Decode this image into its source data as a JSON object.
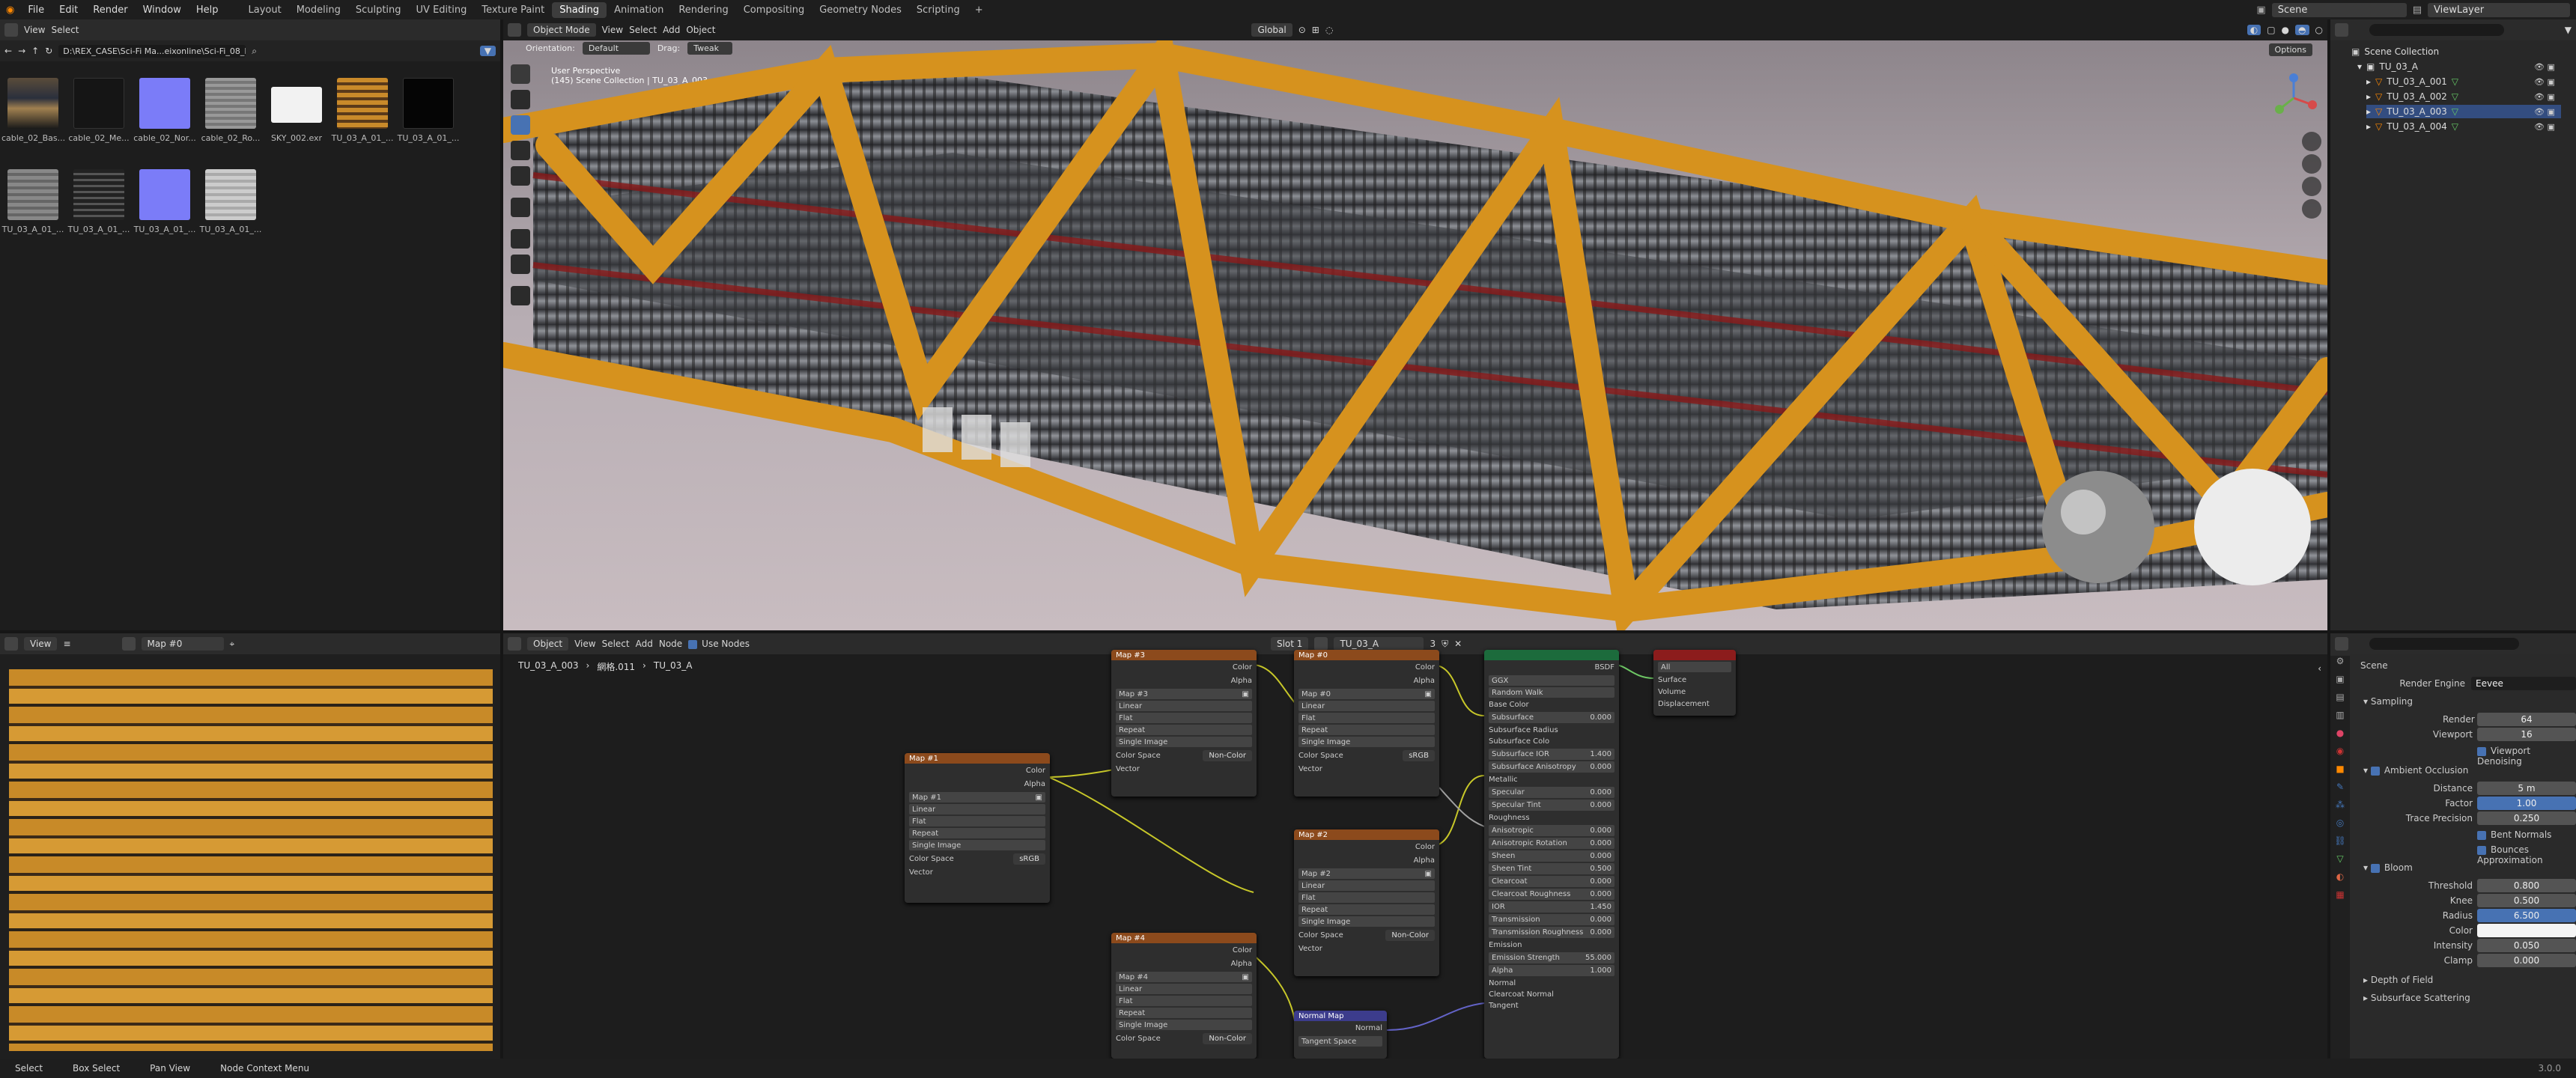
{
  "topmenu": {
    "items": [
      "File",
      "Edit",
      "Render",
      "Window",
      "Help"
    ],
    "workspaces": [
      "Layout",
      "Modeling",
      "Sculpting",
      "UV Editing",
      "Texture Paint",
      "Shading",
      "Animation",
      "Rendering",
      "Compositing",
      "Geometry Nodes",
      "Scripting"
    ],
    "active_workspace": "Shading",
    "scene": "Scene",
    "view_layer": "ViewLayer"
  },
  "filebrowser": {
    "menus": [
      "View",
      "Select"
    ],
    "path": "D:\\REX_CASE\\Sci-Fi Ma...eixonline\\Sci-Fi_08_Free\\",
    "files": [
      "cable_02_Bas...",
      "cable_02_Me...",
      "cable_02_Nor...",
      "cable_02_Ro...",
      "SKY_002.exr",
      "TU_03_A_01_...",
      "TU_03_A_01_...",
      "TU_03_A_01_...",
      "TU_03_A_01_...",
      "TU_03_A_01_...",
      "TU_03_A_01_..."
    ]
  },
  "viewport": {
    "mode": "Object Mode",
    "menus": [
      "View",
      "Select",
      "Add",
      "Object"
    ],
    "orientation_label": "Orientation:",
    "orientation": "Default",
    "drag_label": "Drag:",
    "drag": "Tweak",
    "transform": "Global",
    "options": "Options",
    "overlay_title": "User Perspective",
    "overlay_sub": "(145) Scene Collection | TU_03_A_003"
  },
  "image_editor": {
    "view": "View",
    "image": "Map #0"
  },
  "node_editor": {
    "mode": "Object",
    "menus": [
      "View",
      "Select",
      "Add",
      "Node"
    ],
    "use_nodes": "Use Nodes",
    "slot": "Slot 1",
    "material": "TU_03_A",
    "users": "3",
    "breadcrumb": [
      "TU_03_A_003",
      "網格.011",
      "TU_03_A"
    ],
    "nodes": {
      "map1": {
        "title": "Map #1",
        "image": "Map #1",
        "colorspace": "sRGB"
      },
      "map3": {
        "title": "Map #3",
        "image": "Map #3",
        "colorspace": "Non-Color"
      },
      "map0": {
        "title": "Map #0",
        "image": "Map #0",
        "colorspace": "sRGB"
      },
      "map2": {
        "title": "Map #2",
        "image": "Map #2",
        "colorspace": "Non-Color"
      },
      "map4": {
        "title": "Map #4",
        "image": "Map #4",
        "colorspace": "Non-Color"
      },
      "normalmap": {
        "title": "Normal Map",
        "out": "Normal",
        "space": "Tangent Space"
      },
      "common": {
        "color": "Color",
        "alpha": "Alpha",
        "vector": "Vector",
        "interp": "Linear",
        "proj": "Flat",
        "ext": "Repeat",
        "src": "Single Image",
        "cs_label": "Color Space"
      },
      "bsdf": {
        "out": "BSDF",
        "dist": "GGX",
        "sss": "Random Walk",
        "rows": [
          {
            "n": "Base Color",
            "v": ""
          },
          {
            "n": "Subsurface",
            "v": "0.000"
          },
          {
            "n": "Subsurface Radius",
            "v": ""
          },
          {
            "n": "Subsurface Colo",
            "v": ""
          },
          {
            "n": "Subsurface IOR",
            "v": "1.400"
          },
          {
            "n": "Subsurface Anisotropy",
            "v": "0.000"
          },
          {
            "n": "Metallic",
            "v": ""
          },
          {
            "n": "Specular",
            "v": "0.000"
          },
          {
            "n": "Specular Tint",
            "v": "0.000"
          },
          {
            "n": "Roughness",
            "v": ""
          },
          {
            "n": "Anisotropic",
            "v": "0.000"
          },
          {
            "n": "Anisotropic Rotation",
            "v": "0.000"
          },
          {
            "n": "Sheen",
            "v": "0.000"
          },
          {
            "n": "Sheen Tint",
            "v": "0.500"
          },
          {
            "n": "Clearcoat",
            "v": "0.000"
          },
          {
            "n": "Clearcoat Roughness",
            "v": "0.000"
          },
          {
            "n": "IOR",
            "v": "1.450"
          },
          {
            "n": "Transmission",
            "v": "0.000"
          },
          {
            "n": "Transmission Roughness",
            "v": "0.000"
          },
          {
            "n": "Emission",
            "v": ""
          },
          {
            "n": "Emission Strength",
            "v": "55.000"
          },
          {
            "n": "Alpha",
            "v": "1.000"
          },
          {
            "n": "Normal",
            "v": ""
          },
          {
            "n": "Clearcoat Normal",
            "v": ""
          },
          {
            "n": "Tangent",
            "v": ""
          }
        ]
      },
      "output": {
        "target": "All",
        "inputs": [
          "Surface",
          "Volume",
          "Displacement"
        ]
      }
    }
  },
  "outliner": {
    "title": "Scene Collection",
    "items": [
      "TU_03_A",
      "TU_03_A_001",
      "TU_03_A_002",
      "TU_03_A_003",
      "TU_03_A_004"
    ]
  },
  "properties": {
    "scene": "Scene",
    "render_engine_label": "Render Engine",
    "render_engine": "Eevee",
    "sampling": "Sampling",
    "render_label": "Render",
    "render": "64",
    "viewport_label": "Viewport",
    "viewport": "16",
    "denoise": "Viewport Denoising",
    "ao": "Ambient Occlusion",
    "distance_label": "Distance",
    "distance": "5 m",
    "factor_label": "Factor",
    "factor": "1.00",
    "trace_label": "Trace Precision",
    "trace": "0.250",
    "bent": "Bent Normals",
    "bounces": "Bounces Approximation",
    "bloom": "Bloom",
    "threshold_label": "Threshold",
    "threshold": "0.800",
    "knee_label": "Knee",
    "knee": "0.500",
    "radius_label": "Radius",
    "radius": "6.500",
    "color_label": "Color",
    "intensity_label": "Intensity",
    "intensity": "0.050",
    "clamp_label": "Clamp",
    "clamp": "0.000",
    "dof": "Depth of Field",
    "sss": "Subsurface Scattering"
  },
  "statusbar": {
    "items": [
      "Select",
      "Box Select",
      "Pan View",
      "Node Context Menu"
    ],
    "version": "3.0.0"
  }
}
